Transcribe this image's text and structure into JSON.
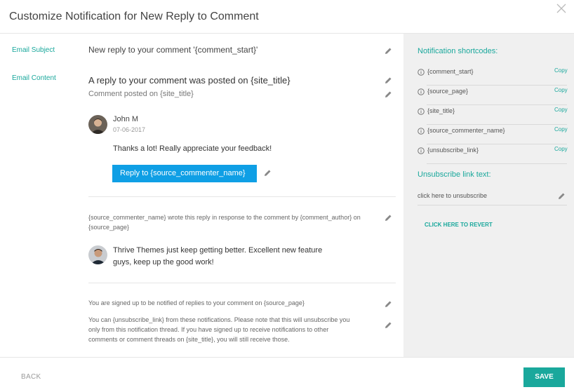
{
  "dialog": {
    "title": "Customize Notification for New Reply to Comment"
  },
  "email_subject": {
    "label": "Email Subject",
    "value": "New reply to your comment '{comment_start}'"
  },
  "email_content": {
    "label": "Email Content",
    "heading": "A reply to your comment was posted on {site_title}",
    "subheading": "Comment posted on {site_title}",
    "reply_comment": {
      "author": "John M",
      "date": "07-06-2017",
      "text": "Thanks a lot! Really appreciate your feedback!",
      "button_label": "Reply to {source_commenter_name}"
    },
    "context_text": "{source_commenter_name} wrote this reply in response to the comment by {comment_author} on {source_page}",
    "original_comment": {
      "text_line1": "Thrive Themes just keep getting better. Excellent new feature",
      "text_line2": "guys, keep up the good work!"
    },
    "signup_text": "You are signed up to be notified of replies to your comment on {source_page}",
    "unsubscribe_text_line1": "You can {unsubscribe_link} from these notifications. Please note that this will unsubscribe you",
    "unsubscribe_text_line2": "only from this notification thread. If you have signed up to receive notifications to other",
    "unsubscribe_text_line3": "comments or comment threads on {site_title}, you will still receive those."
  },
  "sidebar": {
    "shortcodes_title": "Notification shortcodes:",
    "copy_label": "Copy",
    "shortcodes": [
      "{comment_start}",
      "{source_page}",
      "{site_title}",
      "{source_commenter_name}",
      "{unsubscribe_link}"
    ],
    "unsubscribe_title": "Unsubscribe link text:",
    "unsubscribe_value": "click here to unsubscribe",
    "revert_label": "CLICK HERE TO REVERT"
  },
  "footer": {
    "back_label": "BACK",
    "save_label": "SAVE"
  },
  "colors": {
    "accent": "#1aa89c",
    "button_blue": "#0f9fe5",
    "sidebar_bg": "#f0f0f0"
  }
}
